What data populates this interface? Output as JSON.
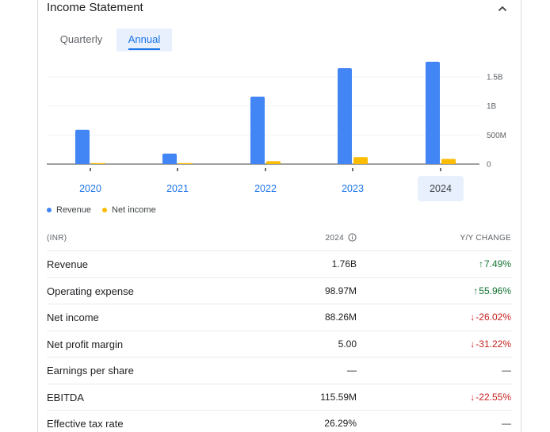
{
  "header": {
    "title": "Income Statement"
  },
  "tabs": [
    {
      "label": "Quarterly",
      "selected": false
    },
    {
      "label": "Annual",
      "selected": true
    }
  ],
  "chart_data": {
    "type": "bar",
    "categories": [
      "2020",
      "2021",
      "2022",
      "2023",
      "2024"
    ],
    "series": [
      {
        "name": "Revenue",
        "color": "#4285f4",
        "values": [
          0.59,
          0.18,
          1.16,
          1.65,
          1.76
        ]
      },
      {
        "name": "Net income",
        "color": "#fbbc04",
        "values": [
          0.01,
          0.006,
          0.05,
          0.12,
          0.088
        ]
      }
    ],
    "y_unit": "B",
    "y_ticks": [
      "0",
      "500M",
      "1B",
      "1.5B"
    ],
    "y_tick_values": [
      0,
      0.5,
      1.0,
      1.5
    ],
    "ylim": [
      0,
      1.5
    ],
    "selected_category": "2024",
    "legend_position": "bottom-left",
    "grid": true
  },
  "legend": [
    {
      "label": "Revenue",
      "color": "#4285f4"
    },
    {
      "label": "Net income",
      "color": "#fbbc04"
    }
  ],
  "table": {
    "headers": {
      "label": "(INR)",
      "year": "2024",
      "change": "Y/Y CHANGE"
    },
    "rows": [
      {
        "label": "Revenue",
        "value": "1.76B",
        "change": "7.49%",
        "dir": "up"
      },
      {
        "label": "Operating expense",
        "value": "98.97M",
        "change": "55.96%",
        "dir": "up"
      },
      {
        "label": "Net income",
        "value": "88.26M",
        "change": "-26.02%",
        "dir": "down"
      },
      {
        "label": "Net profit margin",
        "value": "5.00",
        "change": "-31.22%",
        "dir": "down"
      },
      {
        "label": "Earnings per share",
        "value": "—",
        "change": "—",
        "dir": "none"
      },
      {
        "label": "EBITDA",
        "value": "115.59M",
        "change": "-22.55%",
        "dir": "down"
      },
      {
        "label": "Effective tax rate",
        "value": "26.29%",
        "change": "—",
        "dir": "none"
      }
    ]
  }
}
